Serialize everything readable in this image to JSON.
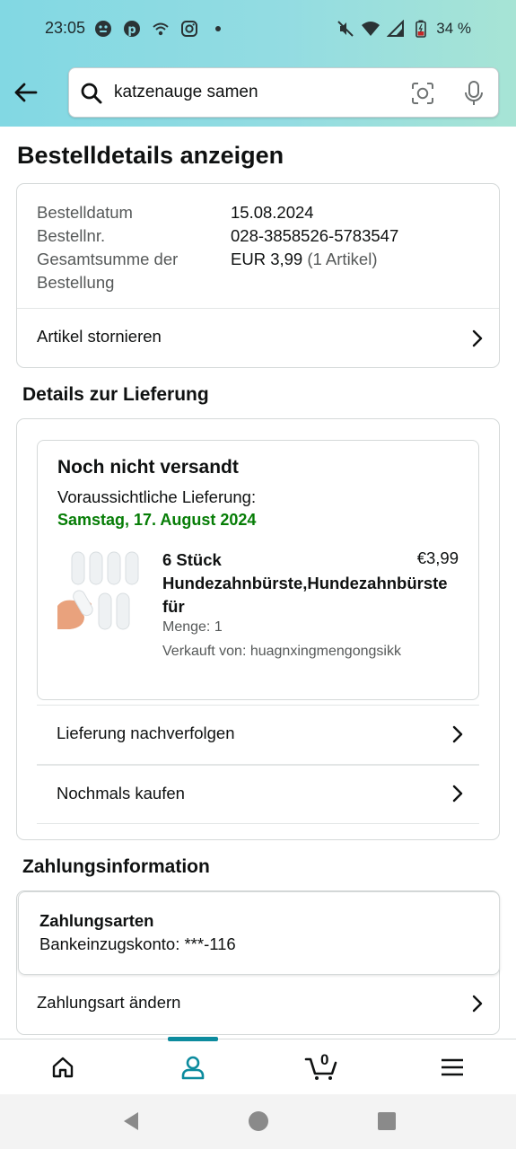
{
  "status_bar": {
    "time": "23:05",
    "battery": "34 %",
    "left_icons": [
      "face-icon",
      "pinterest-icon",
      "wifi-call-icon",
      "instagram-icon",
      "dot-icon"
    ],
    "right_icons": [
      "mute-icon",
      "wifi-icon",
      "signal-icon",
      "battery-icon"
    ]
  },
  "search": {
    "query": "katzenauge samen",
    "icons": [
      "search-icon",
      "camera-icon",
      "mic-icon"
    ]
  },
  "page": {
    "title": "Bestelldetails anzeigen"
  },
  "order_summary": {
    "date_label": "Bestelldatum",
    "date_value": "15.08.2024",
    "number_label": "Bestellnr.",
    "number_value": "028-3858526-5783547",
    "total_label_line1": "Gesamtsumme der",
    "total_label_line2": "Bestellung",
    "total_value": "EUR 3,99",
    "total_items": "(1 Artikel)",
    "cancel_label": "Artikel stornieren"
  },
  "delivery": {
    "section_title": "Details zur Lieferung",
    "status": "Noch nicht versandt",
    "eta_label": "Voraussichtliche Lieferung:",
    "eta_date": "Samstag, 17. August 2024",
    "product": {
      "title_line1": "6 Stück",
      "title_line2": "Hundezahnbürste,Hundezahnbürste",
      "title_line3": "für",
      "price": "€3,99",
      "quantity": "Menge: 1",
      "seller": "Verkauft von: huagnxingmengongsikk"
    },
    "track_label": "Lieferung nachverfolgen",
    "buy_again_label": "Nochmals kaufen"
  },
  "payment": {
    "section_title": "Zahlungsinformation",
    "methods_title": "Zahlungsarten",
    "account": "Bankeinzugskonto: ***-116",
    "change_label": "Zahlungsart ändern"
  },
  "bottom_nav": {
    "items": [
      "home-icon",
      "account-icon",
      "cart-icon",
      "menu-icon"
    ],
    "active": "account-icon",
    "cart_count": "0"
  },
  "colors": {
    "header_gradient_start": "#82d8e3",
    "header_gradient_end": "#a7e4d5",
    "eta_green": "#067d06",
    "active_nav": "#0c8b9e"
  }
}
